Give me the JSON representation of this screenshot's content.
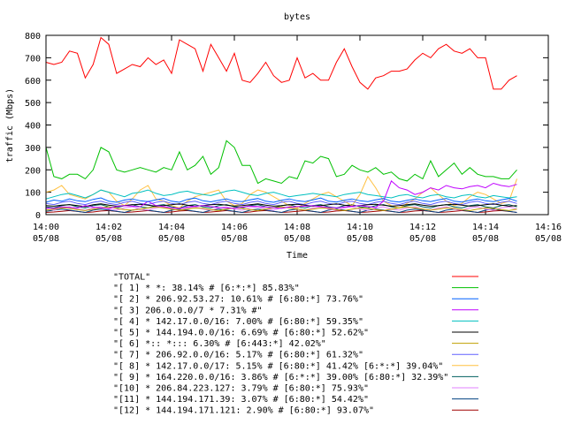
{
  "chart_data": {
    "type": "line",
    "title": "bytes",
    "xlabel": "Time",
    "ylabel": "traffic (Mbps)",
    "ylim": [
      0,
      800
    ],
    "yticks": [
      0,
      100,
      200,
      300,
      400,
      500,
      600,
      700,
      800
    ],
    "xlim": [
      "2008-05-08 14:00",
      "2008-05-08 14:16"
    ],
    "xticks": [
      {
        "t": "2008-05-08 14:00",
        "time": "14:00",
        "date": "05/08"
      },
      {
        "t": "2008-05-08 14:02",
        "time": "14:02",
        "date": "05/08"
      },
      {
        "t": "2008-05-08 14:04",
        "time": "14:04",
        "date": "05/08"
      },
      {
        "t": "2008-05-08 14:06",
        "time": "14:06",
        "date": "05/08"
      },
      {
        "t": "2008-05-08 14:08",
        "time": "14:08",
        "date": "05/08"
      },
      {
        "t": "2008-05-08 14:10",
        "time": "14:10",
        "date": "05/08"
      },
      {
        "t": "2008-05-08 14:12",
        "time": "14:12",
        "date": "05/08"
      },
      {
        "t": "2008-05-08 14:14",
        "time": "14:14",
        "date": "05/08"
      },
      {
        "t": "2008-05-08 14:16",
        "time": "14:16",
        "date": "05/08"
      }
    ],
    "grid": false,
    "legend_position": "bottom",
    "x": [
      "2008-05-08 14:00:00",
      "2008-05-08 14:00:15",
      "2008-05-08 14:00:30",
      "2008-05-08 14:00:45",
      "2008-05-08 14:01:00",
      "2008-05-08 14:01:15",
      "2008-05-08 14:01:30",
      "2008-05-08 14:01:45",
      "2008-05-08 14:02:00",
      "2008-05-08 14:02:15",
      "2008-05-08 14:02:30",
      "2008-05-08 14:02:45",
      "2008-05-08 14:03:00",
      "2008-05-08 14:03:15",
      "2008-05-08 14:03:30",
      "2008-05-08 14:03:45",
      "2008-05-08 14:04:00",
      "2008-05-08 14:04:15",
      "2008-05-08 14:04:30",
      "2008-05-08 14:04:45",
      "2008-05-08 14:05:00",
      "2008-05-08 14:05:15",
      "2008-05-08 14:05:30",
      "2008-05-08 14:05:45",
      "2008-05-08 14:06:00",
      "2008-05-08 14:06:15",
      "2008-05-08 14:06:30",
      "2008-05-08 14:06:45",
      "2008-05-08 14:07:00",
      "2008-05-08 14:07:15",
      "2008-05-08 14:07:30",
      "2008-05-08 14:07:45",
      "2008-05-08 14:08:00",
      "2008-05-08 14:08:15",
      "2008-05-08 14:08:30",
      "2008-05-08 14:08:45",
      "2008-05-08 14:09:00",
      "2008-05-08 14:09:15",
      "2008-05-08 14:09:30",
      "2008-05-08 14:09:45",
      "2008-05-08 14:10:00",
      "2008-05-08 14:10:15",
      "2008-05-08 14:10:30",
      "2008-05-08 14:10:45",
      "2008-05-08 14:11:00",
      "2008-05-08 14:11:15",
      "2008-05-08 14:11:30",
      "2008-05-08 14:11:45",
      "2008-05-08 14:12:00",
      "2008-05-08 14:12:15",
      "2008-05-08 14:12:30",
      "2008-05-08 14:12:45",
      "2008-05-08 14:13:00",
      "2008-05-08 14:13:15",
      "2008-05-08 14:13:30",
      "2008-05-08 14:13:45",
      "2008-05-08 14:14:00",
      "2008-05-08 14:14:15",
      "2008-05-08 14:14:30",
      "2008-05-08 14:14:45",
      "2008-05-08 14:15:00"
    ],
    "series": [
      {
        "name": "\"TOTAL\"",
        "color": "#ff0000",
        "values": [
          680,
          670,
          680,
          730,
          720,
          610,
          670,
          790,
          760,
          630,
          650,
          670,
          660,
          700,
          670,
          690,
          630,
          780,
          760,
          740,
          640,
          760,
          700,
          640,
          720,
          600,
          590,
          630,
          680,
          620,
          590,
          600,
          700,
          610,
          630,
          600,
          600,
          680,
          740,
          660,
          590,
          560,
          610,
          620,
          640,
          640,
          650,
          690,
          720,
          700,
          740,
          760,
          730,
          720,
          740,
          700,
          700,
          560,
          560,
          600,
          620
        ]
      },
      {
        "name": "\"[ 1] * *: 38.14% # [6:*:*] 85.83%\"",
        "color": "#00c000",
        "values": [
          300,
          170,
          160,
          180,
          180,
          160,
          200,
          300,
          280,
          200,
          190,
          200,
          210,
          200,
          190,
          210,
          200,
          280,
          200,
          220,
          260,
          180,
          210,
          330,
          300,
          220,
          220,
          140,
          160,
          150,
          140,
          170,
          160,
          240,
          230,
          260,
          250,
          170,
          180,
          220,
          200,
          190,
          210,
          180,
          190,
          160,
          150,
          180,
          160,
          240,
          170,
          200,
          230,
          180,
          210,
          180,
          170,
          170,
          160,
          160,
          200
        ]
      },
      {
        "name": "\"[ 2] * 206.92.53.27: 10.61% # [6:80:*] 73.76%\"",
        "color": "#0060ff",
        "values": [
          55,
          65,
          60,
          70,
          62,
          58,
          68,
          75,
          60,
          55,
          65,
          70,
          62,
          58,
          66,
          72,
          60,
          55,
          68,
          74,
          62,
          57,
          64,
          70,
          60,
          58,
          66,
          72,
          60,
          55,
          64,
          70,
          62,
          58,
          66,
          74,
          60,
          56,
          64,
          70,
          62,
          58,
          66,
          72,
          60,
          56,
          64,
          70,
          62,
          58,
          66,
          72,
          60,
          56,
          64,
          70,
          62,
          58,
          66,
          72,
          60
        ]
      },
      {
        "name": "\"[ 3] 206.0.0.0/7 * 7.31% #\"",
        "color": "#c000ff",
        "values": [
          30,
          28,
          35,
          32,
          30,
          40,
          34,
          30,
          28,
          36,
          40,
          38,
          35,
          60,
          40,
          36,
          30,
          28,
          34,
          38,
          40,
          36,
          32,
          30,
          28,
          34,
          38,
          36,
          34,
          30,
          28,
          34,
          36,
          38,
          40,
          36,
          32,
          30,
          34,
          38,
          40,
          36,
          32,
          60,
          150,
          120,
          110,
          90,
          100,
          120,
          110,
          130,
          120,
          115,
          125,
          130,
          120,
          140,
          130,
          125,
          135
        ]
      },
      {
        "name": "\"[ 4] * 142.17.0.0/16: 7.00% # [6:80:*] 59.35%\"",
        "color": "#00c0c0",
        "values": [
          70,
          80,
          90,
          95,
          85,
          75,
          90,
          110,
          100,
          90,
          80,
          95,
          100,
          110,
          95,
          85,
          90,
          100,
          105,
          95,
          90,
          85,
          95,
          105,
          110,
          100,
          90,
          85,
          95,
          100,
          90,
          80,
          85,
          90,
          95,
          90,
          85,
          80,
          90,
          95,
          100,
          90,
          85,
          80,
          75,
          85,
          90,
          80,
          75,
          85,
          90,
          80,
          75,
          85,
          90,
          80,
          75,
          85,
          80,
          75,
          80
        ]
      },
      {
        "name": "\"[ 5] * 144.194.0.0/16: 6.69% # [6:80:*] 52.62%\"",
        "color": "#000000",
        "values": [
          40,
          38,
          42,
          45,
          40,
          36,
          44,
          48,
          42,
          38,
          40,
          44,
          46,
          42,
          38,
          40,
          44,
          48,
          42,
          38,
          40,
          44,
          46,
          42,
          38,
          40,
          44,
          48,
          42,
          38,
          40,
          44,
          46,
          42,
          38,
          40,
          44,
          48,
          42,
          38,
          40,
          44,
          46,
          42,
          38,
          40,
          44,
          48,
          42,
          38,
          40,
          44,
          46,
          42,
          38,
          40,
          44,
          48,
          42,
          38,
          40
        ]
      },
      {
        "name": "\"[ 6] *:: *::: 6.30% # [6:443:*] 42.02%\"",
        "color": "#c0a000",
        "values": [
          20,
          25,
          30,
          28,
          22,
          18,
          25,
          30,
          35,
          28,
          22,
          20,
          25,
          30,
          35,
          30,
          25,
          20,
          25,
          30,
          28,
          22,
          18,
          25,
          30,
          28,
          22,
          18,
          25,
          30,
          35,
          30,
          25,
          20,
          25,
          30,
          28,
          22,
          18,
          25,
          30,
          28,
          22,
          18,
          25,
          30,
          35,
          30,
          25,
          20,
          25,
          30,
          28,
          22,
          18,
          25,
          30,
          28,
          22,
          18,
          25
        ]
      },
      {
        "name": "\"[ 7] * 206.92.0.0/16: 5.17% # [6:80:*] 61.32%\"",
        "color": "#6060ff",
        "values": [
          50,
          45,
          55,
          60,
          50,
          45,
          55,
          60,
          50,
          45,
          55,
          60,
          50,
          45,
          55,
          60,
          50,
          45,
          55,
          60,
          50,
          45,
          55,
          60,
          50,
          45,
          55,
          60,
          50,
          45,
          55,
          60,
          50,
          45,
          55,
          60,
          50,
          45,
          55,
          60,
          50,
          45,
          55,
          60,
          50,
          45,
          55,
          60,
          50,
          45,
          55,
          60,
          50,
          45,
          55,
          60,
          50,
          45,
          55,
          60,
          50
        ]
      },
      {
        "name": "\"[ 8] * 142.17.0.0/17: 5.15% # [6:80:*] 41.42% [6:*:*] 39.04%\"",
        "color": "#ffc040",
        "values": [
          100,
          110,
          130,
          90,
          80,
          70,
          90,
          110,
          100,
          60,
          40,
          70,
          110,
          130,
          70,
          60,
          40,
          30,
          60,
          80,
          90,
          100,
          110,
          60,
          40,
          50,
          90,
          110,
          100,
          80,
          60,
          40,
          30,
          50,
          70,
          90,
          100,
          80,
          60,
          40,
          90,
          170,
          120,
          60,
          40,
          30,
          50,
          70,
          100,
          120,
          90,
          60,
          40,
          50,
          80,
          100,
          90,
          70,
          50,
          60,
          160
        ]
      },
      {
        "name": "\"[ 9] * 164.220.0.0/16: 3.86% # [6:*:*] 39.00% [6:80:*] 32.39%\"",
        "color": "#006060",
        "values": [
          35,
          30,
          40,
          45,
          35,
          30,
          40,
          45,
          35,
          30,
          40,
          45,
          35,
          30,
          40,
          45,
          35,
          30,
          40,
          45,
          35,
          30,
          40,
          45,
          35,
          30,
          40,
          45,
          35,
          30,
          40,
          45,
          35,
          30,
          40,
          45,
          35,
          30,
          40,
          45,
          35,
          30,
          40,
          45,
          35,
          30,
          40,
          45,
          35,
          30,
          40,
          45,
          35,
          30,
          40,
          45,
          35,
          30,
          40,
          45,
          35
        ]
      },
      {
        "name": "\"[10] * 206.84.223.127: 3.79% # [6:80:*] 75.93%\"",
        "color": "#e080ff",
        "values": [
          25,
          20,
          30,
          35,
          25,
          20,
          30,
          35,
          25,
          20,
          30,
          35,
          25,
          20,
          30,
          35,
          25,
          20,
          30,
          35,
          25,
          20,
          30,
          35,
          25,
          20,
          30,
          35,
          25,
          20,
          30,
          35,
          25,
          20,
          30,
          35,
          25,
          20,
          30,
          35,
          25,
          20,
          30,
          35,
          25,
          20,
          30,
          35,
          25,
          20,
          30,
          35,
          25,
          20,
          30,
          35,
          25,
          20,
          30,
          35,
          25
        ]
      },
      {
        "name": "\"[11] * 144.194.171.39: 3.07% # [6:80:*] 54.42%\"",
        "color": "#004080",
        "values": [
          15,
          20,
          25,
          20,
          15,
          10,
          20,
          25,
          20,
          15,
          10,
          20,
          25,
          20,
          15,
          10,
          20,
          25,
          20,
          15,
          10,
          20,
          25,
          20,
          15,
          10,
          20,
          25,
          20,
          15,
          10,
          20,
          25,
          20,
          15,
          10,
          20,
          25,
          20,
          15,
          10,
          20,
          25,
          20,
          15,
          10,
          20,
          25,
          20,
          15,
          10,
          20,
          25,
          20,
          15,
          10,
          20,
          25,
          20,
          15,
          10
        ]
      },
      {
        "name": "\"[12] * 144.194.171.121: 2.90% # [6:80:*] 93.07%\"",
        "color": "#a00000",
        "values": [
          10,
          12,
          15,
          18,
          14,
          10,
          12,
          16,
          18,
          14,
          10,
          12,
          15,
          18,
          14,
          10,
          12,
          16,
          18,
          14,
          10,
          12,
          15,
          18,
          14,
          10,
          12,
          16,
          18,
          14,
          10,
          12,
          15,
          18,
          14,
          10,
          12,
          16,
          18,
          14,
          10,
          12,
          15,
          18,
          14,
          10,
          12,
          16,
          18,
          14,
          10,
          12,
          15,
          18,
          14,
          10,
          12,
          16,
          18,
          14,
          10
        ]
      }
    ]
  }
}
